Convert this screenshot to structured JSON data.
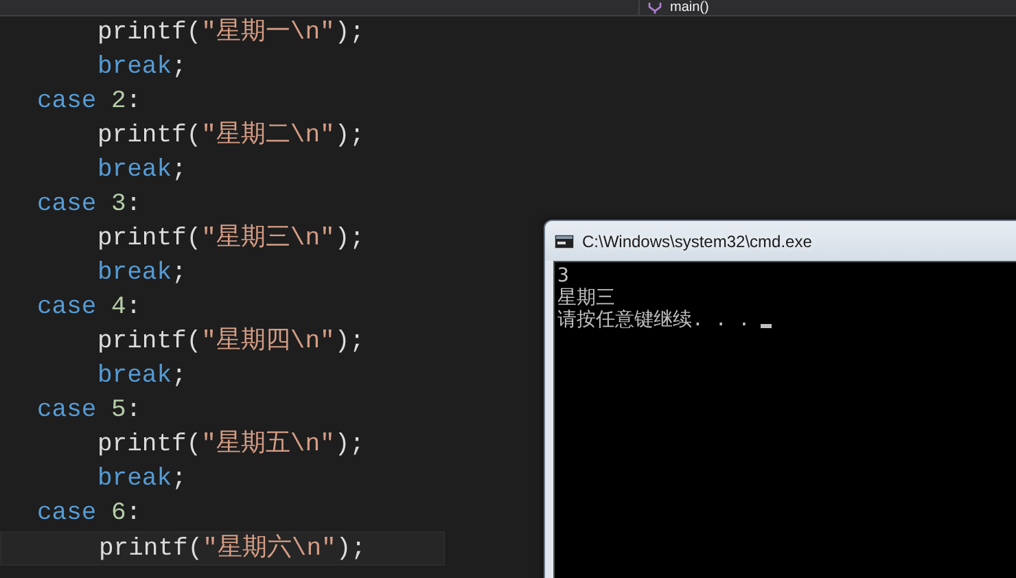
{
  "navigation_bar": {
    "member": "main()"
  },
  "code_lines": [
    {
      "kind": "statement",
      "current": false,
      "tokens": [
        {
          "kind": "function",
          "text": "printf("
        },
        {
          "kind": "string",
          "text": "\"星期一\\n\""
        },
        {
          "kind": "function",
          "text": ");"
        }
      ]
    },
    {
      "kind": "statement",
      "current": false,
      "tokens": [
        {
          "kind": "keyword",
          "text": "break"
        },
        {
          "kind": "function",
          "text": ";"
        }
      ]
    },
    {
      "kind": "label",
      "current": false,
      "tokens": [
        {
          "kind": "keyword",
          "text": "case "
        },
        {
          "kind": "number",
          "text": "2"
        },
        {
          "kind": "function",
          "text": ":"
        }
      ]
    },
    {
      "kind": "statement",
      "current": false,
      "tokens": [
        {
          "kind": "function",
          "text": "printf("
        },
        {
          "kind": "string",
          "text": "\"星期二\\n\""
        },
        {
          "kind": "function",
          "text": ");"
        }
      ]
    },
    {
      "kind": "statement",
      "current": false,
      "tokens": [
        {
          "kind": "keyword",
          "text": "break"
        },
        {
          "kind": "function",
          "text": ";"
        }
      ]
    },
    {
      "kind": "label",
      "current": false,
      "tokens": [
        {
          "kind": "keyword",
          "text": "case "
        },
        {
          "kind": "number",
          "text": "3"
        },
        {
          "kind": "function",
          "text": ":"
        }
      ]
    },
    {
      "kind": "statement",
      "current": false,
      "tokens": [
        {
          "kind": "function",
          "text": "printf("
        },
        {
          "kind": "string",
          "text": "\"星期三\\n\""
        },
        {
          "kind": "function",
          "text": ");"
        }
      ]
    },
    {
      "kind": "statement",
      "current": false,
      "tokens": [
        {
          "kind": "keyword",
          "text": "break"
        },
        {
          "kind": "function",
          "text": ";"
        }
      ]
    },
    {
      "kind": "label",
      "current": false,
      "tokens": [
        {
          "kind": "keyword",
          "text": "case "
        },
        {
          "kind": "number",
          "text": "4"
        },
        {
          "kind": "function",
          "text": ":"
        }
      ]
    },
    {
      "kind": "statement",
      "current": false,
      "tokens": [
        {
          "kind": "function",
          "text": "printf("
        },
        {
          "kind": "string",
          "text": "\"星期四\\n\""
        },
        {
          "kind": "function",
          "text": ");"
        }
      ]
    },
    {
      "kind": "statement",
      "current": false,
      "tokens": [
        {
          "kind": "keyword",
          "text": "break"
        },
        {
          "kind": "function",
          "text": ";"
        }
      ]
    },
    {
      "kind": "label",
      "current": false,
      "tokens": [
        {
          "kind": "keyword",
          "text": "case "
        },
        {
          "kind": "number",
          "text": "5"
        },
        {
          "kind": "function",
          "text": ":"
        }
      ]
    },
    {
      "kind": "statement",
      "current": false,
      "tokens": [
        {
          "kind": "function",
          "text": "printf("
        },
        {
          "kind": "string",
          "text": "\"星期五\\n\""
        },
        {
          "kind": "function",
          "text": ");"
        }
      ]
    },
    {
      "kind": "statement",
      "current": false,
      "tokens": [
        {
          "kind": "keyword",
          "text": "break"
        },
        {
          "kind": "function",
          "text": ";"
        }
      ]
    },
    {
      "kind": "label",
      "current": false,
      "tokens": [
        {
          "kind": "keyword",
          "text": "case "
        },
        {
          "kind": "number",
          "text": "6"
        },
        {
          "kind": "function",
          "text": ":"
        }
      ]
    },
    {
      "kind": "statement",
      "current": true,
      "tokens": [
        {
          "kind": "function",
          "text": "printf("
        },
        {
          "kind": "string",
          "text": "\"星期六\\n\""
        },
        {
          "kind": "function",
          "text": ");"
        }
      ]
    }
  ],
  "console_window": {
    "title": "C:\\Windows\\system32\\cmd.exe",
    "output_lines": [
      "3",
      "星期三",
      "请按任意键继续. . ."
    ]
  }
}
